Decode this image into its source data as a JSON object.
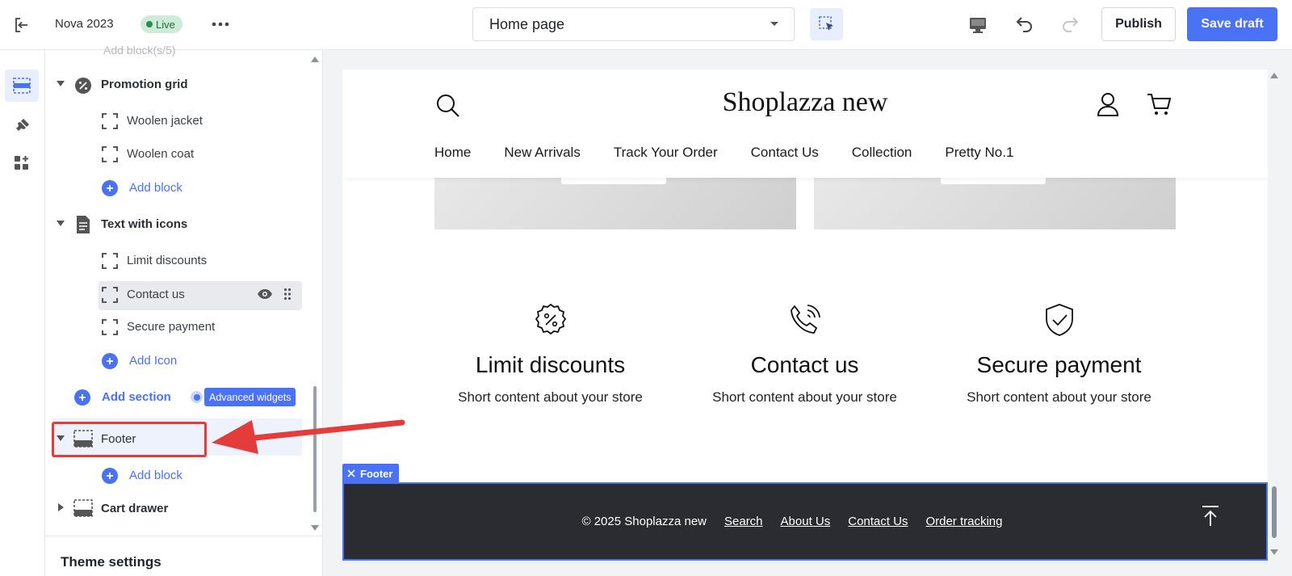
{
  "topbar": {
    "theme_name": "Nova 2023",
    "live_label": "Live",
    "page_select": "Home page",
    "publish_label": "Publish",
    "save_label": "Save draft"
  },
  "sidebar": {
    "faded_item": "Add block(s/5)",
    "sections": [
      {
        "name": "Promotion grid",
        "blocks": [
          "Woolen jacket",
          "Woolen coat"
        ],
        "add_label": "Add block"
      },
      {
        "name": "Text with icons",
        "blocks": [
          "Limit discounts",
          "Contact us",
          "Secure payment"
        ],
        "add_label": "Add Icon"
      }
    ],
    "add_section_label": "Add section",
    "advanced_widgets_label": "Advanced widgets",
    "footer": {
      "name": "Footer",
      "add_label": "Add block"
    },
    "cart_drawer": {
      "name": "Cart drawer"
    },
    "theme_settings_label": "Theme settings"
  },
  "preview": {
    "store_title": "Shoplazza new",
    "nav": [
      "Home",
      "New Arrivals",
      "Track Your Order",
      "Contact Us",
      "Collection",
      "Pretty No.1"
    ],
    "features": [
      {
        "icon": "discount-badge-icon",
        "title": "Limit discounts",
        "text": "Short content about your store"
      },
      {
        "icon": "phone-call-icon",
        "title": "Contact us",
        "text": "Short content about your store"
      },
      {
        "icon": "shield-check-icon",
        "title": "Secure payment",
        "text": "Short content about your store"
      }
    ],
    "footer_tag": "Footer",
    "footer": {
      "copyright": "© 2025 Shoplazza new",
      "links": [
        "Search",
        "About Us",
        "Contact Us",
        "Order tracking"
      ]
    }
  },
  "colors": {
    "accent": "#4a72f5",
    "annotation": "#e43b3b",
    "footer_bg": "#2a2c31"
  }
}
